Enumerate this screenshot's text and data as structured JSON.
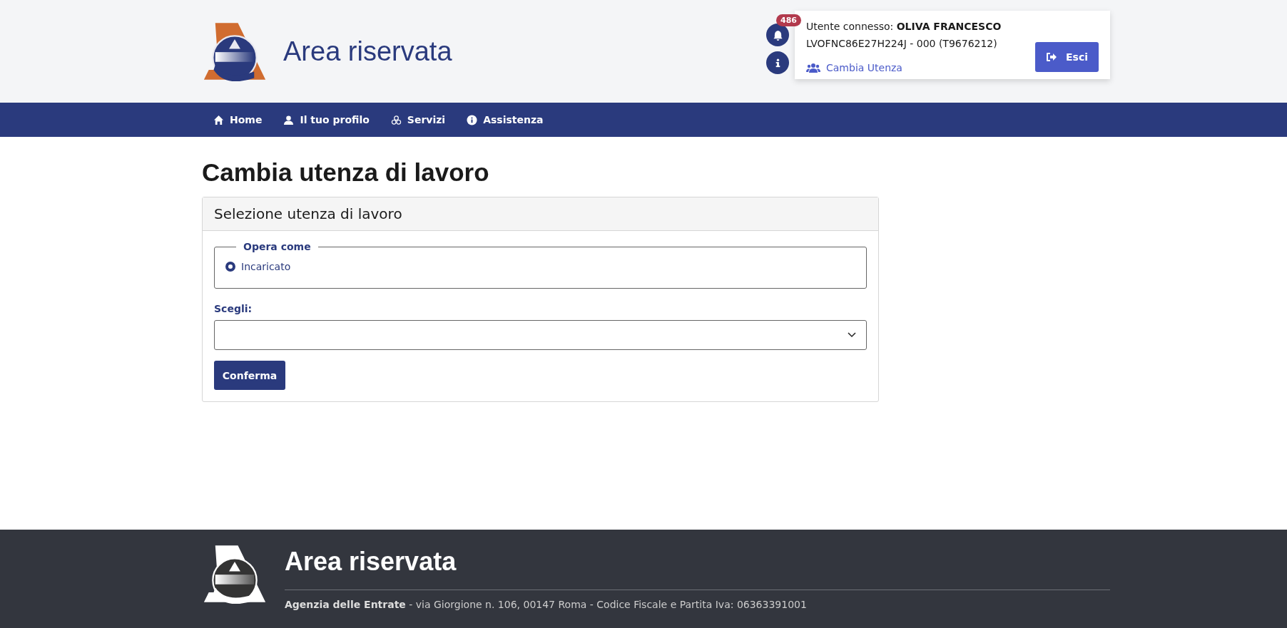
{
  "header": {
    "title": "Area riservata",
    "notifications": {
      "count": "486"
    },
    "user_panel": {
      "connected_label": "Utente connesso: **OLIVA FRANCESCO**",
      "user_code": "LVOFNC86E27H224J - 000 (T9676212)",
      "change_user_link": "Cambia Utenza",
      "logout_button": "Esci"
    }
  },
  "nav": {
    "items": [
      {
        "label": "Home"
      },
      {
        "label": "Il tuo profilo"
      },
      {
        "label": "Servizi"
      },
      {
        "label": "Assistenza"
      }
    ]
  },
  "page": {
    "title": "Cambia utenza di lavoro",
    "card": {
      "title": "Selezione utenza di lavoro",
      "fieldset": {
        "legend": "Opera come",
        "options": [
          {
            "label": "Incaricato",
            "selected": true
          }
        ]
      },
      "select": {
        "label": "Scegli:"
      },
      "confirm_button": "Conferma"
    }
  },
  "footer": {
    "title": "Area riservata",
    "address": "**Agenzia delle Entrate** - via Giorgione n. 106, 00147 Roma - Codice Fiscale e Partita Iva: 06363391001"
  }
}
